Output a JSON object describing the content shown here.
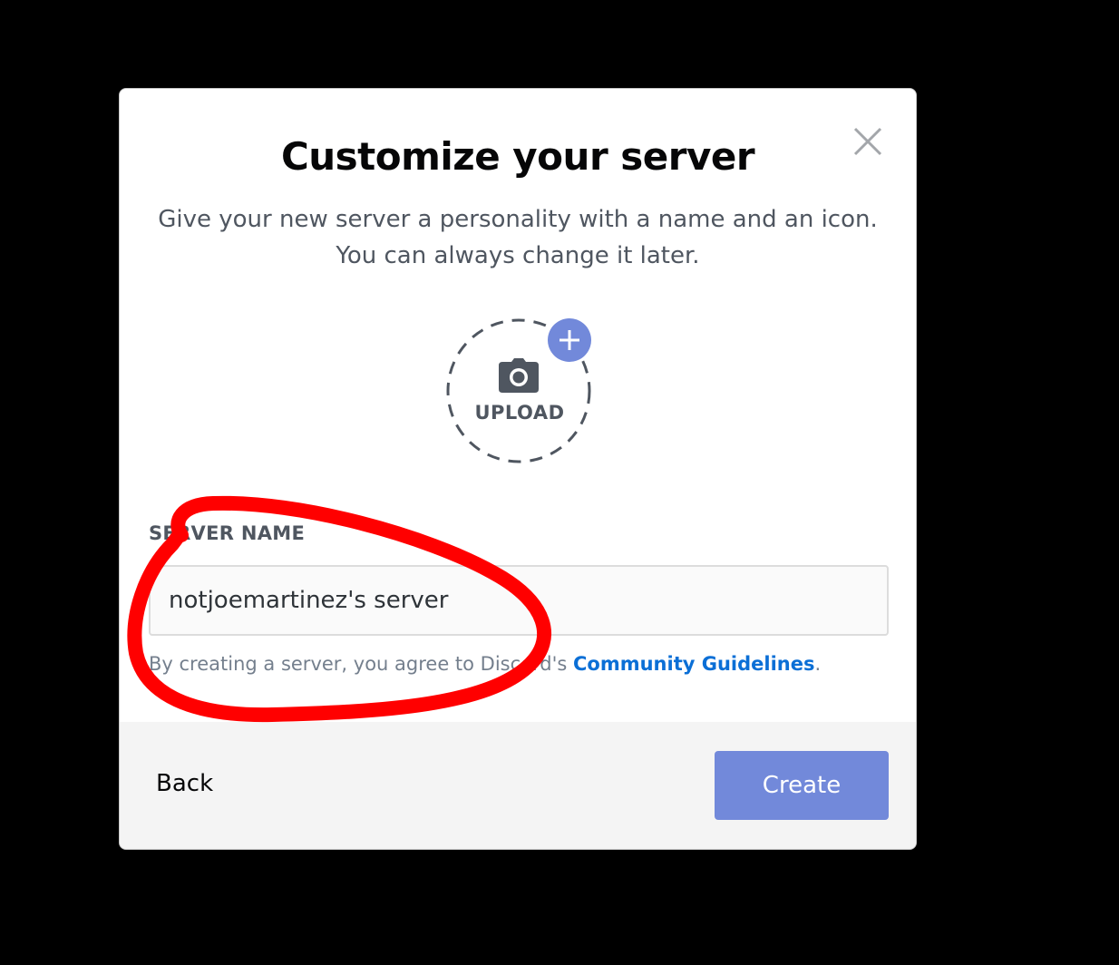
{
  "modal": {
    "title": "Customize your server",
    "subtitle_line1": "Give your new server a personality with a name and an icon.",
    "subtitle_line2": "You can always change it later.",
    "close_icon": "close-icon"
  },
  "upload": {
    "label": "UPLOAD",
    "icon": "camera-icon",
    "badge_icon": "plus-icon",
    "badge_color": "#7289da"
  },
  "server_name": {
    "label": "SERVER NAME",
    "value": "notjoemartinez's server"
  },
  "legal": {
    "text": "By creating a server, you agree to Discord's ",
    "link": "Community Guidelines",
    "suffix": "."
  },
  "footer": {
    "back_label": "Back",
    "create_label": "Create",
    "create_color": "#7289da"
  },
  "annotation": {
    "color": "#ff0000"
  }
}
